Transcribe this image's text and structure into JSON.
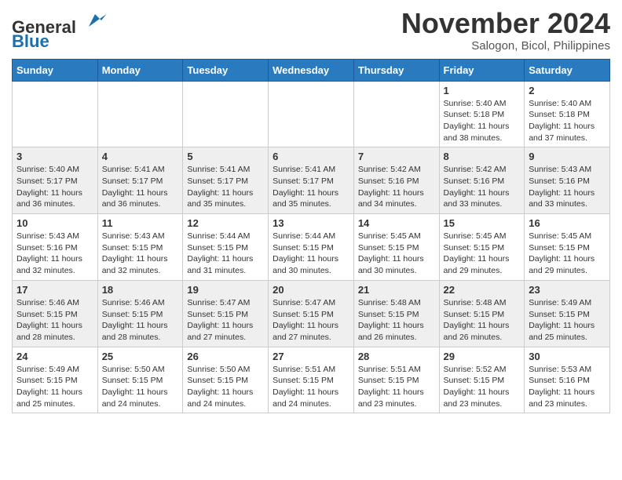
{
  "header": {
    "logo_line1": "General",
    "logo_line2": "Blue",
    "month": "November 2024",
    "location": "Salogon, Bicol, Philippines"
  },
  "weekdays": [
    "Sunday",
    "Monday",
    "Tuesday",
    "Wednesday",
    "Thursday",
    "Friday",
    "Saturday"
  ],
  "weeks": [
    [
      {
        "day": "",
        "info": ""
      },
      {
        "day": "",
        "info": ""
      },
      {
        "day": "",
        "info": ""
      },
      {
        "day": "",
        "info": ""
      },
      {
        "day": "",
        "info": ""
      },
      {
        "day": "1",
        "info": "Sunrise: 5:40 AM\nSunset: 5:18 PM\nDaylight: 11 hours\nand 38 minutes."
      },
      {
        "day": "2",
        "info": "Sunrise: 5:40 AM\nSunset: 5:18 PM\nDaylight: 11 hours\nand 37 minutes."
      }
    ],
    [
      {
        "day": "3",
        "info": "Sunrise: 5:40 AM\nSunset: 5:17 PM\nDaylight: 11 hours\nand 36 minutes."
      },
      {
        "day": "4",
        "info": "Sunrise: 5:41 AM\nSunset: 5:17 PM\nDaylight: 11 hours\nand 36 minutes."
      },
      {
        "day": "5",
        "info": "Sunrise: 5:41 AM\nSunset: 5:17 PM\nDaylight: 11 hours\nand 35 minutes."
      },
      {
        "day": "6",
        "info": "Sunrise: 5:41 AM\nSunset: 5:17 PM\nDaylight: 11 hours\nand 35 minutes."
      },
      {
        "day": "7",
        "info": "Sunrise: 5:42 AM\nSunset: 5:16 PM\nDaylight: 11 hours\nand 34 minutes."
      },
      {
        "day": "8",
        "info": "Sunrise: 5:42 AM\nSunset: 5:16 PM\nDaylight: 11 hours\nand 33 minutes."
      },
      {
        "day": "9",
        "info": "Sunrise: 5:43 AM\nSunset: 5:16 PM\nDaylight: 11 hours\nand 33 minutes."
      }
    ],
    [
      {
        "day": "10",
        "info": "Sunrise: 5:43 AM\nSunset: 5:16 PM\nDaylight: 11 hours\nand 32 minutes."
      },
      {
        "day": "11",
        "info": "Sunrise: 5:43 AM\nSunset: 5:15 PM\nDaylight: 11 hours\nand 32 minutes."
      },
      {
        "day": "12",
        "info": "Sunrise: 5:44 AM\nSunset: 5:15 PM\nDaylight: 11 hours\nand 31 minutes."
      },
      {
        "day": "13",
        "info": "Sunrise: 5:44 AM\nSunset: 5:15 PM\nDaylight: 11 hours\nand 30 minutes."
      },
      {
        "day": "14",
        "info": "Sunrise: 5:45 AM\nSunset: 5:15 PM\nDaylight: 11 hours\nand 30 minutes."
      },
      {
        "day": "15",
        "info": "Sunrise: 5:45 AM\nSunset: 5:15 PM\nDaylight: 11 hours\nand 29 minutes."
      },
      {
        "day": "16",
        "info": "Sunrise: 5:45 AM\nSunset: 5:15 PM\nDaylight: 11 hours\nand 29 minutes."
      }
    ],
    [
      {
        "day": "17",
        "info": "Sunrise: 5:46 AM\nSunset: 5:15 PM\nDaylight: 11 hours\nand 28 minutes."
      },
      {
        "day": "18",
        "info": "Sunrise: 5:46 AM\nSunset: 5:15 PM\nDaylight: 11 hours\nand 28 minutes."
      },
      {
        "day": "19",
        "info": "Sunrise: 5:47 AM\nSunset: 5:15 PM\nDaylight: 11 hours\nand 27 minutes."
      },
      {
        "day": "20",
        "info": "Sunrise: 5:47 AM\nSunset: 5:15 PM\nDaylight: 11 hours\nand 27 minutes."
      },
      {
        "day": "21",
        "info": "Sunrise: 5:48 AM\nSunset: 5:15 PM\nDaylight: 11 hours\nand 26 minutes."
      },
      {
        "day": "22",
        "info": "Sunrise: 5:48 AM\nSunset: 5:15 PM\nDaylight: 11 hours\nand 26 minutes."
      },
      {
        "day": "23",
        "info": "Sunrise: 5:49 AM\nSunset: 5:15 PM\nDaylight: 11 hours\nand 25 minutes."
      }
    ],
    [
      {
        "day": "24",
        "info": "Sunrise: 5:49 AM\nSunset: 5:15 PM\nDaylight: 11 hours\nand 25 minutes."
      },
      {
        "day": "25",
        "info": "Sunrise: 5:50 AM\nSunset: 5:15 PM\nDaylight: 11 hours\nand 24 minutes."
      },
      {
        "day": "26",
        "info": "Sunrise: 5:50 AM\nSunset: 5:15 PM\nDaylight: 11 hours\nand 24 minutes."
      },
      {
        "day": "27",
        "info": "Sunrise: 5:51 AM\nSunset: 5:15 PM\nDaylight: 11 hours\nand 24 minutes."
      },
      {
        "day": "28",
        "info": "Sunrise: 5:51 AM\nSunset: 5:15 PM\nDaylight: 11 hours\nand 23 minutes."
      },
      {
        "day": "29",
        "info": "Sunrise: 5:52 AM\nSunset: 5:15 PM\nDaylight: 11 hours\nand 23 minutes."
      },
      {
        "day": "30",
        "info": "Sunrise: 5:53 AM\nSunset: 5:16 PM\nDaylight: 11 hours\nand 23 minutes."
      }
    ]
  ]
}
